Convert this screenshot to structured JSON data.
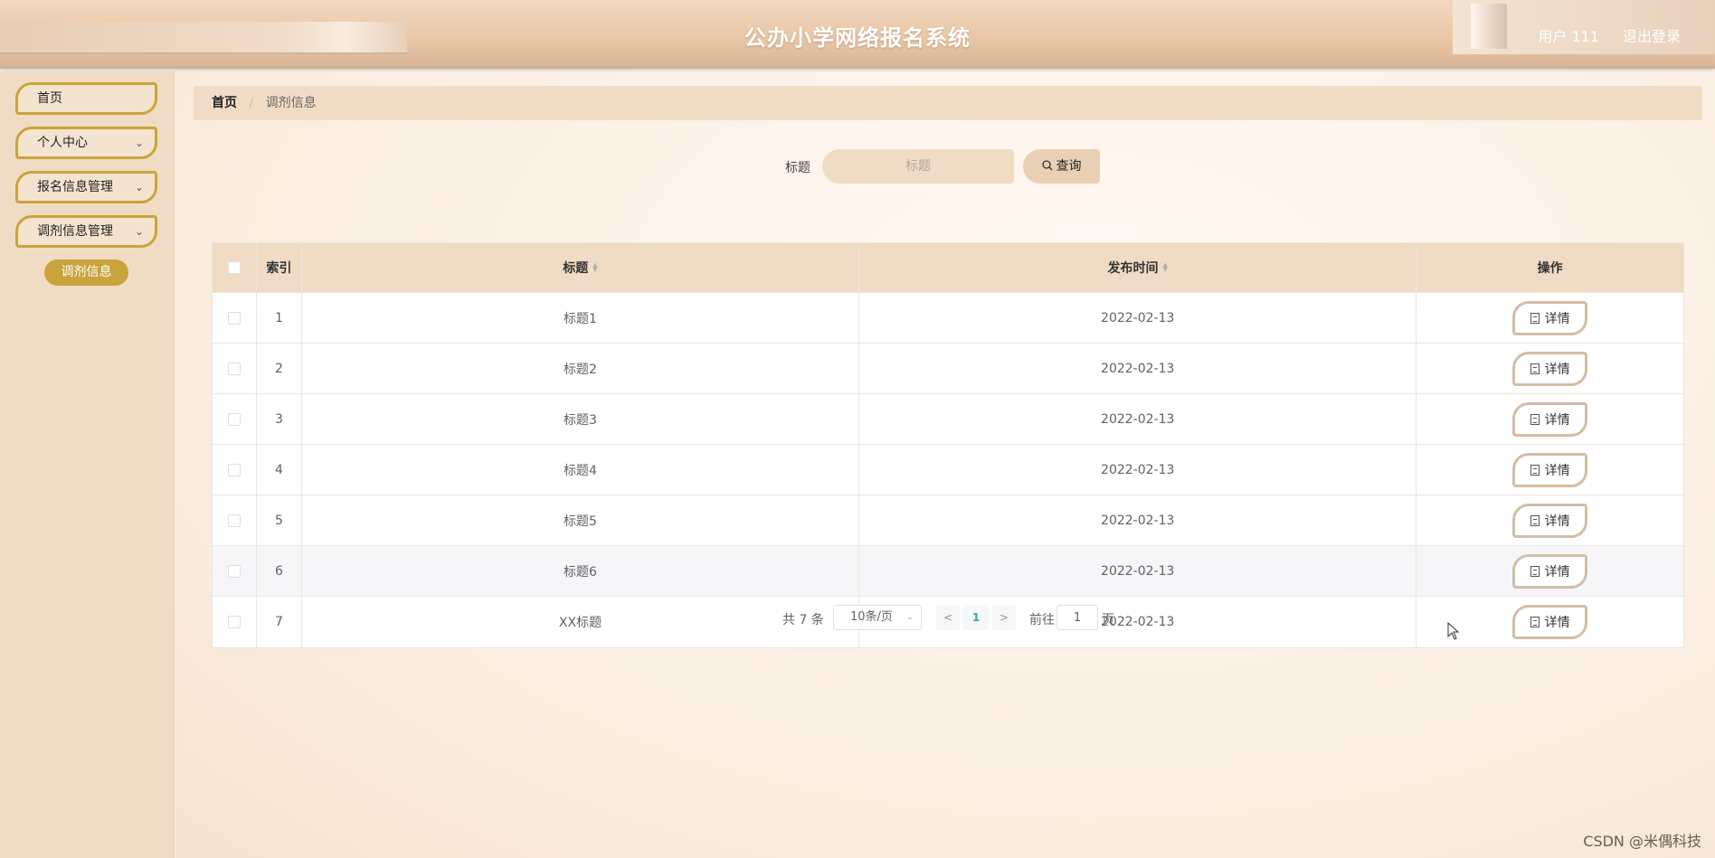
{
  "header": {
    "title": "公办小学网络报名系统",
    "user": "用户 111",
    "logout": "退出登录"
  },
  "sidebar": {
    "items": [
      {
        "label": "首页",
        "has_chevron": false
      },
      {
        "label": "个人中心",
        "has_chevron": true
      },
      {
        "label": "报名信息管理",
        "has_chevron": true
      },
      {
        "label": "调剂信息管理",
        "has_chevron": true
      }
    ],
    "sub_item": "调剂信息"
  },
  "breadcrumb": {
    "home": "首页",
    "separator": "/",
    "current": "调剂信息"
  },
  "search": {
    "label": "标题",
    "placeholder": "标题",
    "button": "查询",
    "button_icon": "search-icon"
  },
  "table": {
    "headers": {
      "index": "索引",
      "title": "标题",
      "time": "发布时间",
      "op": "操作"
    },
    "detail_label": "详情",
    "rows": [
      {
        "index": "1",
        "title": "标题1",
        "time": "2022-02-13"
      },
      {
        "index": "2",
        "title": "标题2",
        "time": "2022-02-13"
      },
      {
        "index": "3",
        "title": "标题3",
        "time": "2022-02-13"
      },
      {
        "index": "4",
        "title": "标题4",
        "time": "2022-02-13"
      },
      {
        "index": "5",
        "title": "标题5",
        "time": "2022-02-13"
      },
      {
        "index": "6",
        "title": "标题6",
        "time": "2022-02-13"
      },
      {
        "index": "7",
        "title": "XX标题",
        "time": "2022-02-13"
      }
    ]
  },
  "pagination": {
    "total": "共 7 条",
    "page_size": "10条/页",
    "current_page": "1",
    "goto_label": "前往",
    "goto_value": "1",
    "page_suffix": "页"
  },
  "watermark": "CSDN @米偶科技",
  "colors": {
    "accent": "#c9a33b",
    "panel": "#f0dcc4",
    "active_page": "#1fb19e"
  }
}
